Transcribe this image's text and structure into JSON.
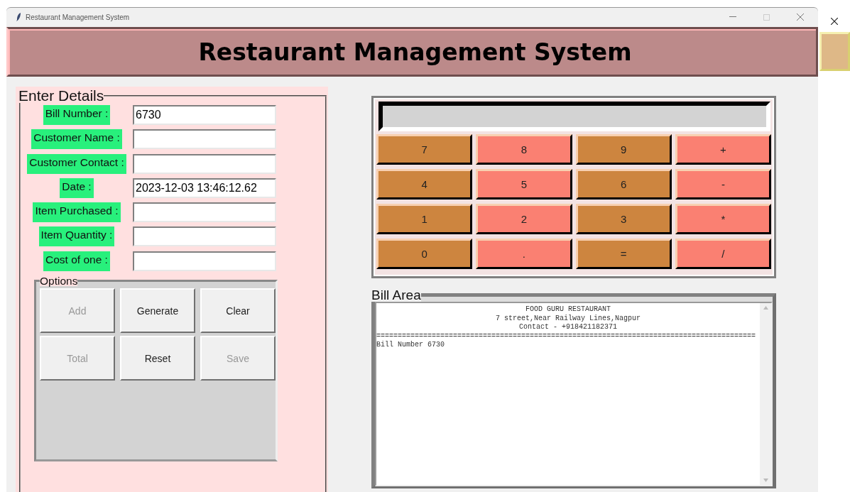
{
  "window": {
    "title": "Restaurant Management System"
  },
  "header": {
    "title": "Restaurant Management System"
  },
  "details": {
    "legend": "Enter Details",
    "fields": [
      {
        "label": "Bill Number :",
        "value": "6730"
      },
      {
        "label": "Customer Name :"
      },
      {
        "label": "Customer Contact :"
      },
      {
        "label": "Date :",
        "value": "2023-12-03 13:46:12.62"
      },
      {
        "label": "Item Purchased :"
      },
      {
        "label": "Item Quantity :"
      },
      {
        "label": "Cost of one :"
      }
    ]
  },
  "options": {
    "legend": "Options",
    "buttons": [
      {
        "label": "Add",
        "disabled": true
      },
      {
        "label": "Generate",
        "disabled": false
      },
      {
        "label": "Clear",
        "disabled": false
      },
      {
        "label": "Total",
        "disabled": true
      },
      {
        "label": "Reset",
        "disabled": false
      },
      {
        "label": "Save",
        "disabled": true
      }
    ]
  },
  "calculator": {
    "keys": [
      {
        "label": "7",
        "color": "#cd853f"
      },
      {
        "label": "8",
        "color": "#fa8072"
      },
      {
        "label": "9",
        "color": "#cd853f"
      },
      {
        "label": "+",
        "color": "#fa8072"
      },
      {
        "label": "4",
        "color": "#cd853f"
      },
      {
        "label": "5",
        "color": "#fa8072"
      },
      {
        "label": "6",
        "color": "#cd853f"
      },
      {
        "label": "-",
        "color": "#fa8072"
      },
      {
        "label": "1",
        "color": "#cd853f"
      },
      {
        "label": "2",
        "color": "#fa8072"
      },
      {
        "label": "3",
        "color": "#cd853f"
      },
      {
        "label": "*",
        "color": "#fa8072"
      },
      {
        "label": "0",
        "color": "#cd853f"
      },
      {
        "label": ".",
        "color": "#fa8072"
      },
      {
        "label": "=",
        "color": "#cd853f"
      },
      {
        "label": "/",
        "color": "#fa8072"
      }
    ]
  },
  "bill": {
    "legend": "Bill Area",
    "header_lines": [
      "FOOD GURU RESTAURANT",
      "7 street,Near Railway Lines,Nagpur",
      "Contact - +918421182371"
    ],
    "separator": "=========================================================================================",
    "lines": [
      "Bill Number 6730"
    ]
  }
}
